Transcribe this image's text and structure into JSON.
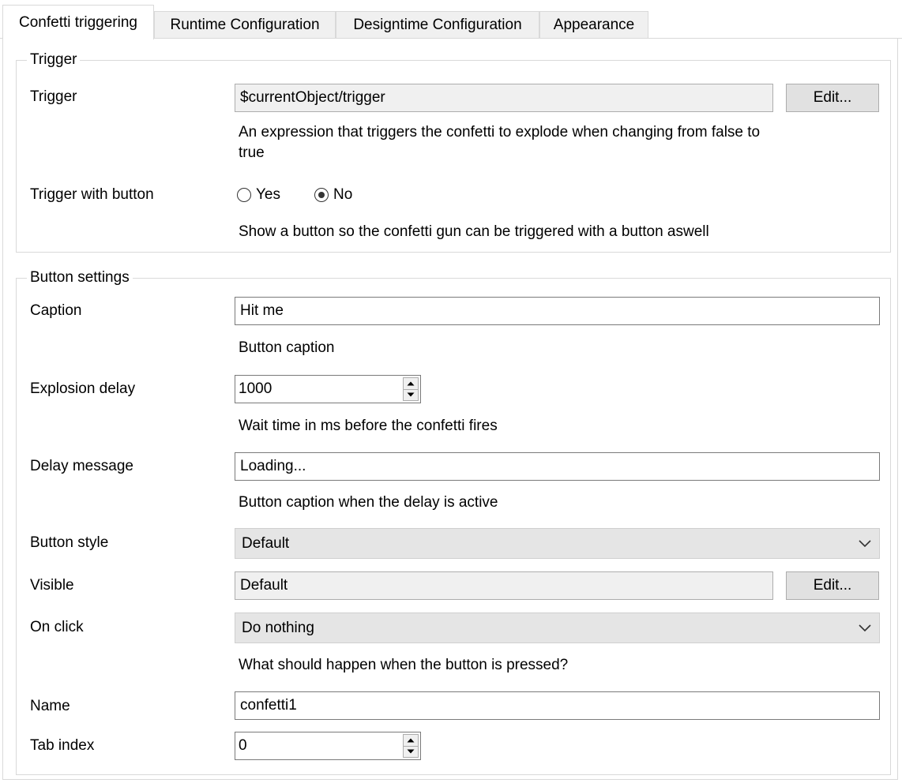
{
  "tabs": [
    {
      "label": "Confetti triggering",
      "active": true
    },
    {
      "label": "Runtime Configuration",
      "active": false
    },
    {
      "label": "Designtime Configuration",
      "active": false
    },
    {
      "label": "Appearance",
      "active": false
    }
  ],
  "trigger_group": {
    "legend": "Trigger",
    "trigger": {
      "label": "Trigger",
      "value": "$currentObject/trigger",
      "edit_label": "Edit...",
      "help_line1": "An expression that triggers the confetti to explode when changing from false to",
      "help_line2": "true"
    },
    "trigger_with_button": {
      "label": "Trigger with button",
      "yes_label": "Yes",
      "no_label": "No",
      "selected": "No",
      "help": "Show a button so the confetti gun can be triggered with a button aswell"
    }
  },
  "button_group": {
    "legend": "Button settings",
    "caption": {
      "label": "Caption",
      "value": "Hit me",
      "help": "Button caption"
    },
    "explosion_delay": {
      "label": "Explosion delay",
      "value": "1000",
      "help": "Wait time in ms before the confetti fires"
    },
    "delay_message": {
      "label": "Delay message",
      "value": "Loading...",
      "help": "Button caption when the delay is active"
    },
    "button_style": {
      "label": "Button style",
      "value": "Default"
    },
    "visible": {
      "label": "Visible",
      "value": "Default",
      "edit_label": "Edit..."
    },
    "on_click": {
      "label": "On click",
      "value": "Do nothing",
      "help": "What should happen when the button is pressed?"
    },
    "name": {
      "label": "Name",
      "value": "confetti1"
    },
    "tab_index": {
      "label": "Tab index",
      "value": "0"
    }
  },
  "icons": [
    "chevron-down-icon",
    "spin-up-icon",
    "spin-down-icon",
    "radio-button-icon"
  ],
  "colors": {
    "border": "#d9d9d9",
    "readonly_bg": "#f0f0f0",
    "button_bg": "#e1e1e1",
    "combo_bg": "#e5e5e5"
  }
}
